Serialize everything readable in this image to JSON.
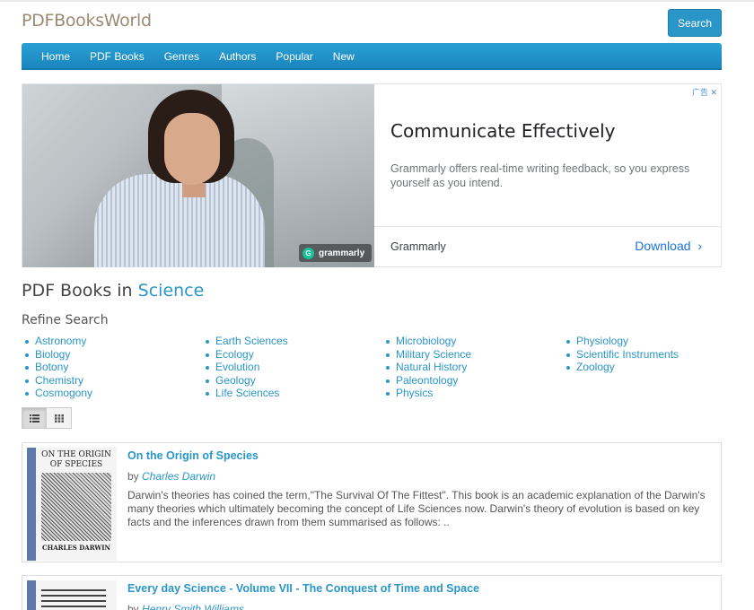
{
  "header": {
    "logo": "PDFBooksWorld",
    "search_label": "Search"
  },
  "nav": [
    "Home",
    "PDF Books",
    "Genres",
    "Authors",
    "Popular",
    "New"
  ],
  "ad": {
    "corner": "广告 ✕",
    "badge": "grammarly",
    "headline": "Communicate Effectively",
    "description": "Grammarly offers real-time writing feedback, so you express yourself as you intend.",
    "advertiser": "Grammarly",
    "cta": "Download"
  },
  "page": {
    "title_prefix": "PDF Books in",
    "title_category": "Science",
    "refine_label": "Refine Search"
  },
  "genres": [
    [
      "Astronomy",
      "Biology",
      "Botony",
      "Chemistry",
      "Cosmogony"
    ],
    [
      "Earth Sciences",
      "Ecology",
      "Evolution",
      "Geology",
      "Life Sciences"
    ],
    [
      "Microbiology",
      "Military Science",
      "Natural History",
      "Paleontology",
      "Physics"
    ],
    [
      "Physiology",
      "Scientific Instruments",
      "Zoology"
    ]
  ],
  "view_modes": [
    "list",
    "grid"
  ],
  "books": [
    {
      "title": "On the Origin of Species",
      "by": "by",
      "author": "Charles Darwin",
      "cover_title": "ON THE ORIGIN OF SPECIES",
      "cover_author": "CHARLES DARWIN",
      "description": "Darwin's theories has coined the term,\"The Survival Of The Fittest\".  This book is an academic explanation of the Darwin's many theories which ultimately becoming the concept of Life Sciences now.   Darwin's theory of evolution is based on key facts and the inferences drawn from them summarised as follows:      .."
    },
    {
      "title": "Every day Science - Volume VII - The Conquest of Time and Space",
      "by": "by",
      "author": "Henry Smith Williams"
    }
  ]
}
